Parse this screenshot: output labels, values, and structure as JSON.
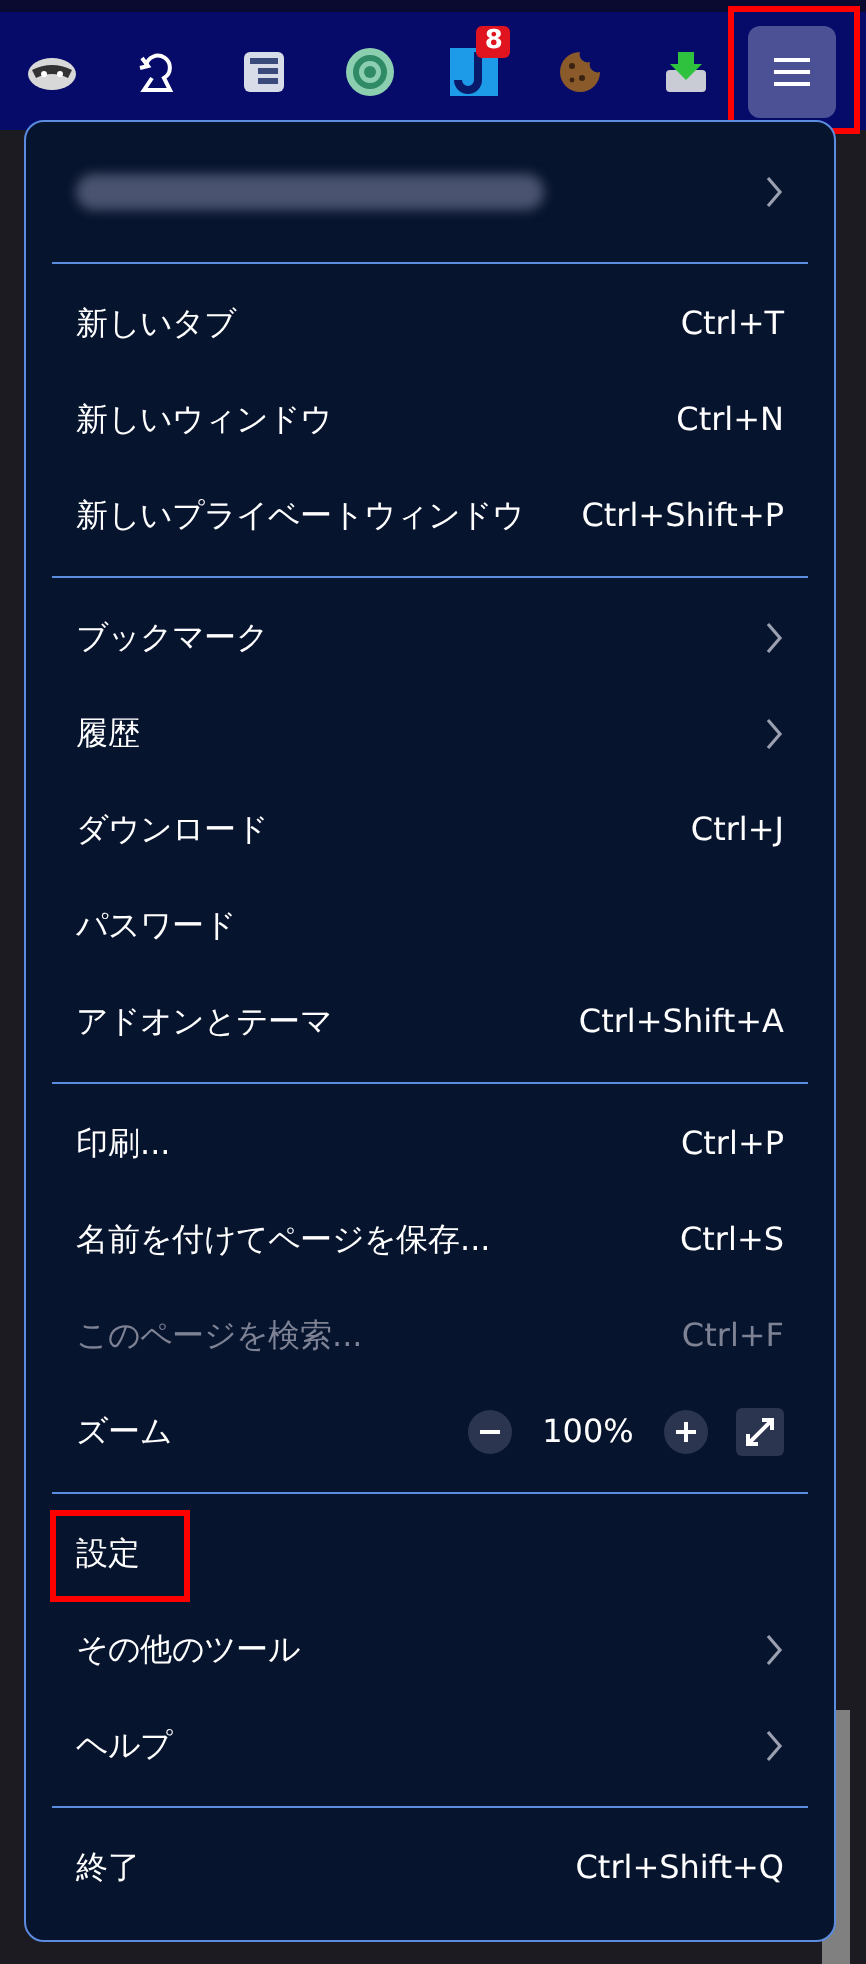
{
  "toolbar": {
    "buttons": [
      {
        "kind": "raccoon",
        "selected": false
      },
      {
        "kind": "hat",
        "selected": false
      },
      {
        "kind": "panel",
        "selected": false
      },
      {
        "kind": "ring",
        "selected": false
      },
      {
        "kind": "letter",
        "selected": false,
        "badge": "8"
      },
      {
        "kind": "cookie",
        "selected": false
      },
      {
        "kind": "tray",
        "selected": false
      },
      {
        "kind": "menu",
        "selected": true,
        "annotated": true
      }
    ]
  },
  "menu": {
    "account": {
      "kind": "blurred"
    },
    "sections": [
      [
        {
          "kind": "action",
          "label": "新しいタブ",
          "shortcut": "Ctrl+T",
          "disabled": false,
          "annotated": false
        },
        {
          "kind": "action",
          "label": "新しいウィンドウ",
          "shortcut": "Ctrl+N",
          "disabled": false,
          "annotated": false
        },
        {
          "kind": "action",
          "label": "新しいプライベートウィンドウ",
          "shortcut": "Ctrl+Shift+P",
          "disabled": false,
          "annotated": false
        }
      ],
      [
        {
          "kind": "submenu",
          "label": "ブックマーク",
          "disabled": false,
          "annotated": false
        },
        {
          "kind": "submenu",
          "label": "履歴",
          "disabled": false,
          "annotated": false
        },
        {
          "kind": "action",
          "label": "ダウンロード",
          "shortcut": "Ctrl+J",
          "disabled": false,
          "annotated": false
        },
        {
          "kind": "action",
          "label": "パスワード",
          "disabled": false,
          "annotated": false
        },
        {
          "kind": "action",
          "label": "アドオンとテーマ",
          "shortcut": "Ctrl+Shift+A",
          "disabled": false,
          "annotated": false
        }
      ],
      [
        {
          "kind": "action",
          "label": "印刷...",
          "shortcut": "Ctrl+P",
          "disabled": false,
          "annotated": false
        },
        {
          "kind": "action",
          "label": "名前を付けてページを保存...",
          "shortcut": "Ctrl+S",
          "disabled": false,
          "annotated": false
        },
        {
          "kind": "action",
          "label": "このページを検索...",
          "shortcut": "Ctrl+F",
          "disabled": true,
          "annotated": false
        },
        {
          "kind": "zoom",
          "label": "ズーム",
          "value": "100%",
          "disabled": false,
          "annotated": false
        }
      ],
      [
        {
          "kind": "action",
          "label": "設定",
          "disabled": false,
          "annotated": true
        },
        {
          "kind": "submenu",
          "label": "その他のツール",
          "disabled": false,
          "annotated": false
        },
        {
          "kind": "submenu",
          "label": "ヘルプ",
          "disabled": false,
          "annotated": false
        }
      ],
      [
        {
          "kind": "action",
          "label": "終了",
          "shortcut": "Ctrl+Shift+Q",
          "disabled": false,
          "annotated": false
        }
      ]
    ]
  }
}
